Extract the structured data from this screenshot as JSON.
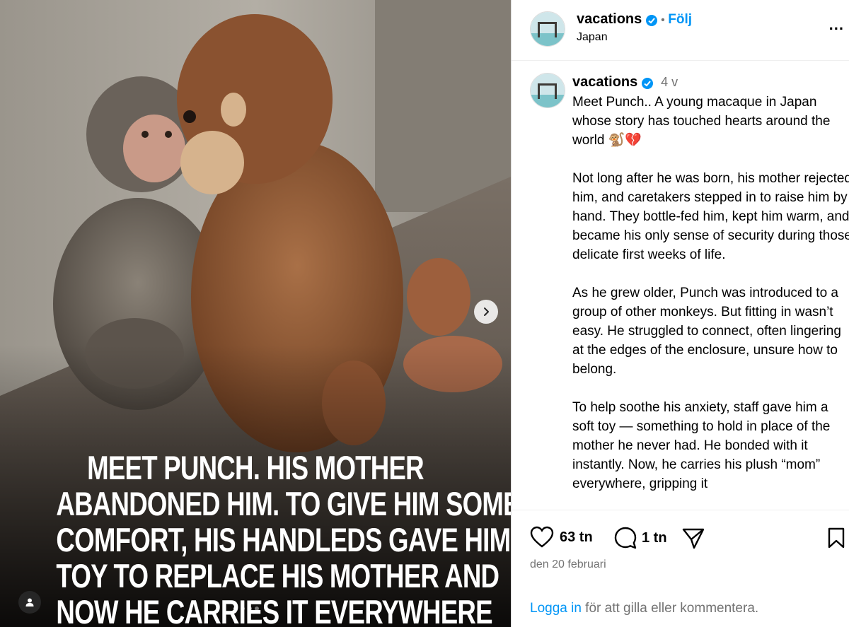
{
  "post": {
    "image_caption_lines": [
      "MEET PUNCH. HIS MOTHER",
      "ABANDONED HIM. TO GIVE HIM SOME",
      "COMFORT, HIS HANDLEDS GAVE HIM A",
      "TOY TO REPLACE HIS MOTHER AND",
      "NOW HE CARRIES IT EVERYWHERE"
    ],
    "carousel_dots": 4,
    "active_dot": 0
  },
  "header": {
    "username": "vacations",
    "separator": "•",
    "follow_label": "Följ",
    "location": "Japan",
    "more_label": "..."
  },
  "comment": {
    "username": "vacations",
    "age": "4 v",
    "text": "Meet Punch.. A young macaque in Japan whose story has touched hearts around the world 🐒💔\n\nNot long after he was born, his mother rejected him, and caretakers stepped in to raise him by hand. They bottle-fed him, kept him warm, and became his only sense of security during those delicate first weeks of life.\n\nAs he grew older, Punch was introduced to a group of other monkeys. But fitting in wasn’t easy. He struggled to connect, often lingering at the edges of the enclosure, unsure how to belong.\n\nTo help soothe his anxiety, staff gave him a soft toy — something to hold in place of the mother he never had. He bonded with it instantly. Now, he carries his plush “mom” everywhere, gripping it"
  },
  "actions": {
    "likes": "63 tn",
    "comments": "1 tn",
    "date": "den 20 februari",
    "login_link": "Logga in",
    "login_rest": " för att gilla eller kommentera."
  },
  "colors": {
    "accent": "#0095f6",
    "verified": "#0095f6",
    "muted": "#737373"
  }
}
